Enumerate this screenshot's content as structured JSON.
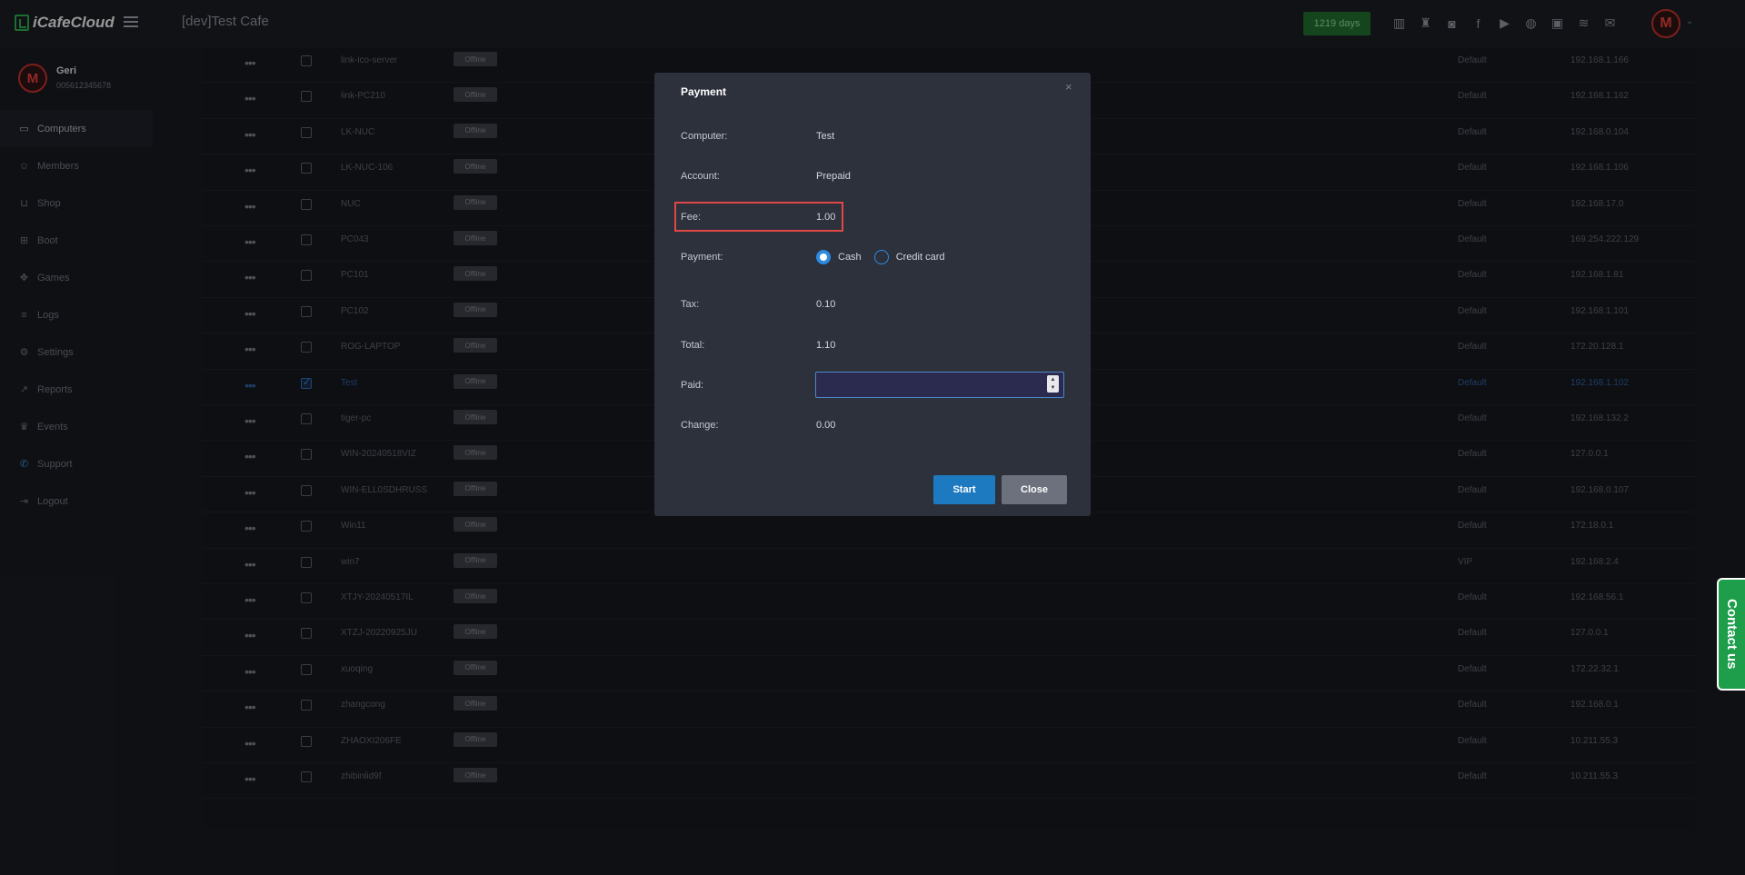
{
  "app": {
    "logo_text": "iCafeCloud",
    "cafe_title": "[dev]Test Cafe",
    "days_badge": "1219 days"
  },
  "top_icons": [
    "chart-icon",
    "trophy-icon",
    "discord-icon",
    "facebook-icon",
    "youtube-icon",
    "globe-icon",
    "id-card-icon",
    "handshake-icon",
    "mail-icon"
  ],
  "user": {
    "name": "Geri",
    "phone": "005612345678",
    "avatar_letter": "M"
  },
  "sidebar": {
    "items": [
      {
        "label": "Computers",
        "icon": "monitor-icon",
        "glyph": "▭"
      },
      {
        "label": "Members",
        "icon": "users-icon",
        "glyph": "☺"
      },
      {
        "label": "Shop",
        "icon": "cart-icon",
        "glyph": "⊔"
      },
      {
        "label": "Boot",
        "icon": "windows-icon",
        "glyph": "⊞"
      },
      {
        "label": "Games",
        "icon": "gamepad-icon",
        "glyph": "✥"
      },
      {
        "label": "Logs",
        "icon": "list-icon",
        "glyph": "≡"
      },
      {
        "label": "Settings",
        "icon": "gear-icon",
        "glyph": "⚙"
      },
      {
        "label": "Reports",
        "icon": "chart-line-icon",
        "glyph": "↗"
      },
      {
        "label": "Events",
        "icon": "crown-icon",
        "glyph": "♛"
      },
      {
        "label": "Support",
        "icon": "phone-icon",
        "glyph": "✆"
      },
      {
        "label": "Logout",
        "icon": "logout-icon",
        "glyph": "⇥"
      }
    ]
  },
  "table": {
    "rows": [
      {
        "name": "link-ico-server",
        "status": "Offline",
        "group": "Default",
        "ip": "192.168.1.166"
      },
      {
        "name": "link-PC210",
        "status": "Offline",
        "group": "Default",
        "ip": "192.168.1.162"
      },
      {
        "name": "LK-NUC",
        "status": "Offline",
        "group": "Default",
        "ip": "192.168.0.104"
      },
      {
        "name": "LK-NUC-106",
        "status": "Offline",
        "group": "Default",
        "ip": "192.168.1.106"
      },
      {
        "name": "NUC",
        "status": "Offline",
        "group": "Default",
        "ip": "192.168.17.0"
      },
      {
        "name": "PC043",
        "status": "Offline",
        "group": "Default",
        "ip": "169.254.222.129"
      },
      {
        "name": "PC101",
        "status": "Offline",
        "group": "Default",
        "ip": "192.168.1.81"
      },
      {
        "name": "PC102",
        "status": "Offline",
        "group": "Default",
        "ip": "192.168.1.101"
      },
      {
        "name": "ROG-LAPTOP",
        "status": "Offline",
        "group": "Default",
        "ip": "172.20.128.1"
      },
      {
        "name": "Test",
        "status": "Offline",
        "group": "Default",
        "ip": "192.168.1.102"
      },
      {
        "name": "tiger-pc",
        "status": "Offline",
        "group": "Default",
        "ip": "192.168.132.2"
      },
      {
        "name": "WIN-20240518VIZ",
        "status": "Offline",
        "group": "Default",
        "ip": "127.0.0.1"
      },
      {
        "name": "WIN-ELL0SDHRUSS",
        "status": "Offline",
        "group": "Default",
        "ip": "192.168.0.107"
      },
      {
        "name": "Win11",
        "status": "Offline",
        "group": "Default",
        "ip": "172.18.0.1"
      },
      {
        "name": "win7",
        "status": "Offline",
        "group": "VIP",
        "ip": "192.168.2.4"
      },
      {
        "name": "XTJY-20240517IL",
        "status": "Offline",
        "group": "Default",
        "ip": "192.168.56.1"
      },
      {
        "name": "XTZJ-20220925JU",
        "status": "Offline",
        "group": "Default",
        "ip": "127.0.0.1"
      },
      {
        "name": "xuoqing",
        "status": "Offline",
        "group": "Default",
        "ip": "172.22.32.1"
      },
      {
        "name": "zhangcong",
        "status": "Offline",
        "group": "Default",
        "ip": "192.168.0.1"
      },
      {
        "name": "ZHAOXI206FE",
        "status": "Offline",
        "group": "Default",
        "ip": "10.211.55.3"
      },
      {
        "name": "zhibinlid9f",
        "status": "Offline",
        "group": "Default",
        "ip": "10.211.55.3"
      }
    ],
    "selected_row": "Test"
  },
  "modal": {
    "title": "Payment",
    "close_glyph": "×",
    "computer_label": "Computer:",
    "computer_value": "Test",
    "account_label": "Account:",
    "account_value": "Prepaid",
    "fee_label": "Fee:",
    "fee_value": "1.00",
    "payment_label": "Payment:",
    "payment_options": [
      "Cash",
      "Credit card"
    ],
    "payment_selected": "Cash",
    "tax_label": "Tax:",
    "tax_value": "0.10",
    "total_label": "Total:",
    "total_value": "1.10",
    "paid_label": "Paid:",
    "paid_value": "",
    "change_label": "Change:",
    "change_value": "0.00",
    "start_button": "Start",
    "close_button": "Close"
  },
  "contact_tab": "Contact us",
  "colors": {
    "accent": "#1e7ac0",
    "badge_green": "#1f6b2d",
    "contact_green": "#1e9e4a",
    "highlight_red": "#e04848"
  }
}
